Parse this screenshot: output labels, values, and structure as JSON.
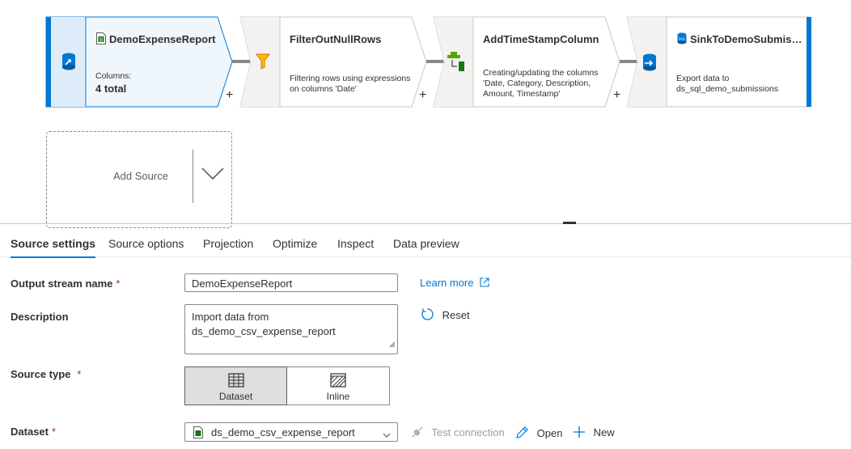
{
  "flow": {
    "nodes": [
      {
        "title": "DemoExpenseReport",
        "desc_label": "Columns:",
        "desc_value": "4 total",
        "icon": "csv-source-icon"
      },
      {
        "title": "FilterOutNullRows",
        "desc": "Filtering rows using expressions on columns 'Date'",
        "icon": "filter-funnel-icon"
      },
      {
        "title": "AddTimeStampColumn",
        "desc": "Creating/updating the columns 'Date, Category, Description, Amount, Timestamp'",
        "icon": "derived-column-icon"
      },
      {
        "title": "SinkToDemoSubmiss...",
        "desc": "Export data to ds_sql_demo_submissions",
        "icon": "sql-sink-icon"
      }
    ],
    "add_plus": "+",
    "add_source": "Add Source"
  },
  "tabs": [
    "Source settings",
    "Source options",
    "Projection",
    "Optimize",
    "Inspect",
    "Data preview"
  ],
  "form": {
    "output_stream": {
      "label": "Output stream name",
      "required": "*",
      "value": "DemoExpenseReport"
    },
    "learn_more": "Learn more",
    "description": {
      "label": "Description",
      "value": "Import data from ds_demo_csv_expense_report"
    },
    "reset": "Reset",
    "source_type": {
      "label": "Source type",
      "required": "*",
      "options": [
        "Dataset",
        "Inline"
      ],
      "selected": "Dataset"
    },
    "dataset": {
      "label": "Dataset",
      "required": "*",
      "value": "ds_demo_csv_expense_report"
    },
    "test_connection": "Test connection",
    "open": "Open",
    "new": "New"
  },
  "colors": {
    "accent": "#0078d4",
    "selected_node_bg": "#eff6fc",
    "node_stripe": "#0078d4",
    "required": "#a4262c"
  }
}
